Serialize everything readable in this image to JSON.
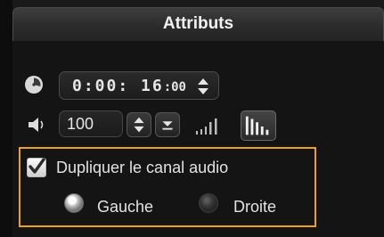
{
  "panel": {
    "tab_title": "Attributs"
  },
  "clip": {
    "timecode_main": "0:00: 16",
    "timecode_frames": ":00",
    "volume": "100"
  },
  "audio": {
    "duplicate_label": "Dupliquer le canal audio",
    "duplicate_checked": true,
    "channel_left_label": "Gauche",
    "channel_right_label": "Droite",
    "selected_channel": "Gauche"
  },
  "colors": {
    "highlight_border": "#f0a020",
    "background": "#141414",
    "text": "#e2e2e2"
  },
  "icons": {
    "clock": "clock-icon",
    "speaker": "speaker-icon",
    "spin": "spin-updown-icon",
    "volume_down": "volume-down-arrow-icon",
    "wave_small": "waveform-small-icon",
    "wave_large": "waveform-large-icon"
  }
}
